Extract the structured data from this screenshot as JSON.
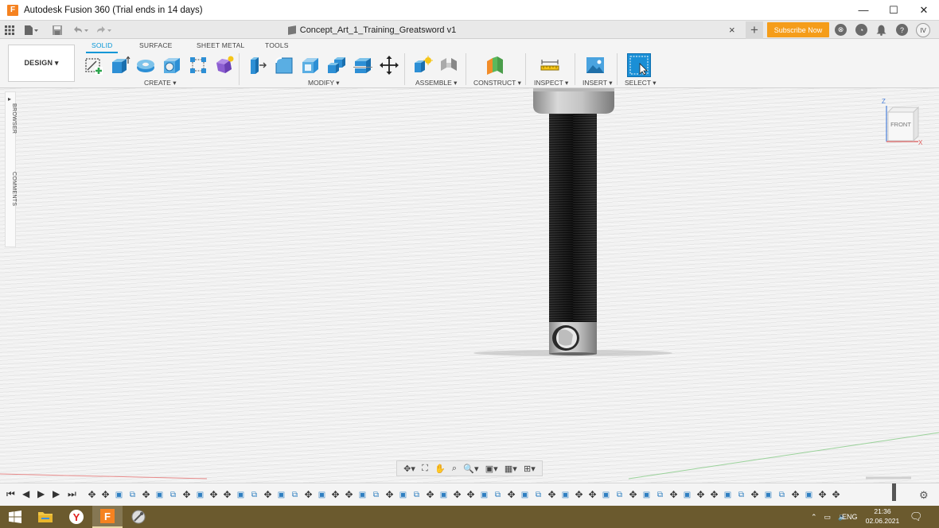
{
  "window": {
    "title": "Autodesk Fusion 360 (Trial ends in 14 days)",
    "app_logo": "F",
    "controls": {
      "minimize": "—",
      "maximize": "☐",
      "close": "✕"
    }
  },
  "tabbar": {
    "document_name": "Concept_Art_1_Training_Greatsword v1",
    "close": "×",
    "new_tab": "+",
    "subscribe_label": "Subscribe Now",
    "user_initials": "IV"
  },
  "toolbar": {
    "workspace_label": "DESIGN ▾",
    "tabs": [
      "SOLID",
      "SURFACE",
      "SHEET METAL",
      "TOOLS"
    ],
    "active_tab": "SOLID",
    "groups": {
      "create": "CREATE ▾",
      "modify": "MODIFY ▾",
      "assemble": "ASSEMBLE ▾",
      "construct": "CONSTRUCT ▾",
      "inspect": "INSPECT ▾",
      "insert": "INSERT ▾",
      "select": "SELECT ▾"
    }
  },
  "side_panel": {
    "browser_label": "BROWSER",
    "comments_label": "COMMENTS"
  },
  "viewcube": {
    "face_label": "FRONT",
    "axis_z": "Z",
    "axis_x": "X"
  },
  "timeline": {
    "item_count": 56
  },
  "taskbar": {
    "language": "ENG",
    "time": "21:36",
    "date": "02.06.2021"
  },
  "colors": {
    "accent": "#0696d7",
    "subscribe": "#f59d1a",
    "taskbar": "#6b5a2e",
    "logo": "#f58220"
  }
}
